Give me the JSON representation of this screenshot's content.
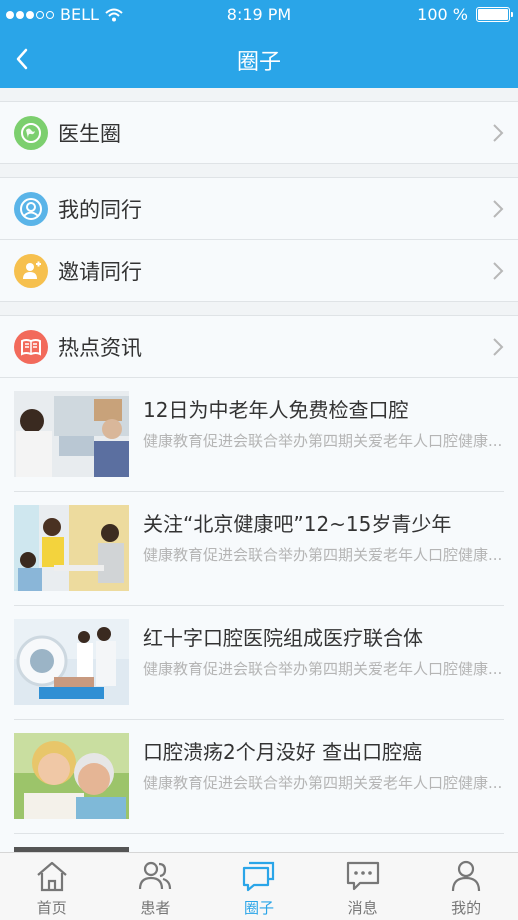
{
  "status": {
    "carrier": "BELL",
    "time": "8:19 PM",
    "battery": "100 %"
  },
  "nav": {
    "title": "圈子"
  },
  "menu": [
    {
      "label": "医生圈",
      "icon": "globe-icon",
      "color": "#7ccf6e"
    },
    {
      "label": "我的同行",
      "icon": "person-icon",
      "color": "#5ab4e8"
    },
    {
      "label": "邀请同行",
      "icon": "add-person-icon",
      "color": "#f6c04e"
    },
    {
      "label": "热点资讯",
      "icon": "book-icon",
      "color": "#f26a5b"
    }
  ],
  "news": [
    {
      "title": "12日为中老年人免费检查口腔",
      "desc": "健康教育促进会联合举办第四期关爱老年人口腔健康..."
    },
    {
      "title": "关注“北京健康吧”12~15岁青少年",
      "desc": "健康教育促进会联合举办第四期关爱老年人口腔健康..."
    },
    {
      "title": "红十字口腔医院组成医疗联合体",
      "desc": "健康教育促进会联合举办第四期关爱老年人口腔健康..."
    },
    {
      "title": "口腔溃疡2个月没好 查出口腔癌",
      "desc": "健康教育促进会联合举办第四期关爱老年人口腔健康..."
    }
  ],
  "tabs": [
    {
      "label": "首页",
      "icon": "home-icon"
    },
    {
      "label": "患者",
      "icon": "patients-icon"
    },
    {
      "label": "圈子",
      "icon": "chat-circle-icon",
      "active": true
    },
    {
      "label": "消息",
      "icon": "message-icon"
    },
    {
      "label": "我的",
      "icon": "profile-icon"
    }
  ],
  "colors": {
    "brand": "#2aa5e8"
  }
}
